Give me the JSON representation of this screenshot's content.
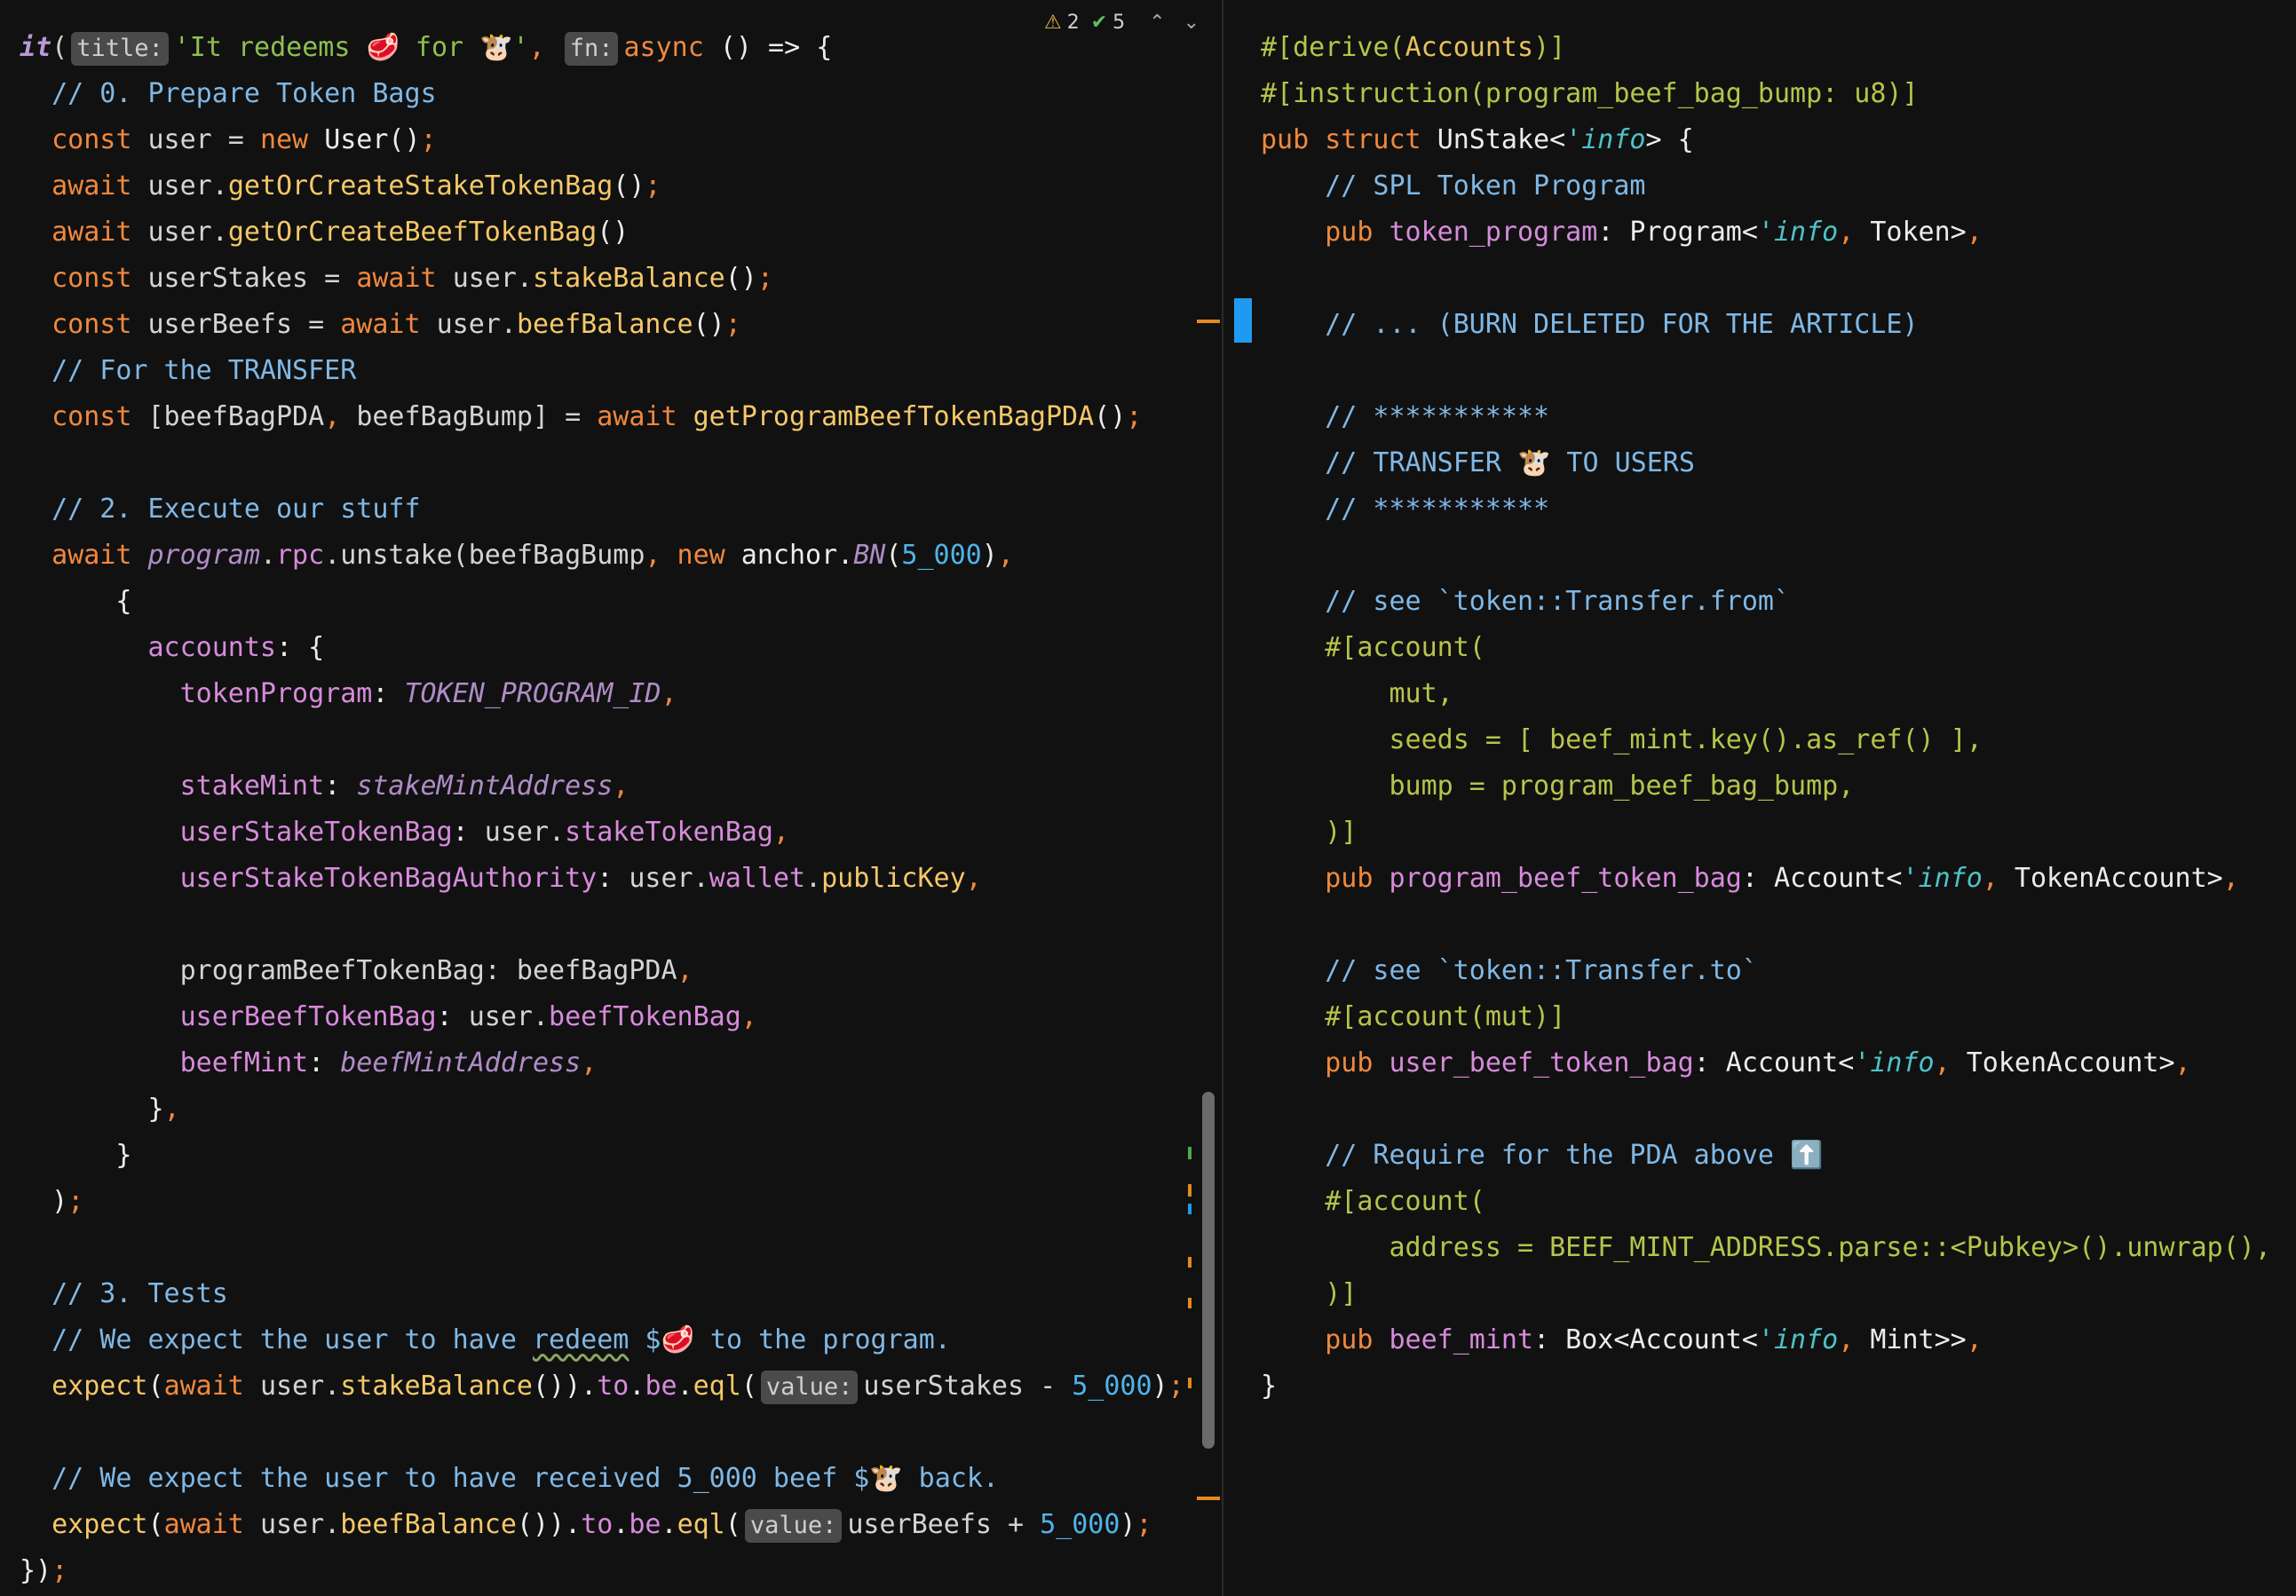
{
  "toolbar": {
    "warning_icon": "warning-triangle-icon",
    "warning_count": "2",
    "ok_icon": "check-double-icon",
    "ok_count": "5",
    "up_icon": "chevron-up-icon",
    "down_icon": "chevron-down-icon"
  },
  "left_editor": {
    "language": "typescript",
    "lines": [
      "it( title: 'It redeems 🥩 for 🐮', fn: async () => {",
      "// 0. Prepare Token Bags",
      "const user = new User();",
      "await user.getOrCreateStakeTokenBag();",
      "await user.getOrCreateBeefTokenBag()",
      "const userStakes = await user.stakeBalance();",
      "const userBeefs = await user.beefBalance();",
      "// For the TRANSFER",
      "const [beefBagPDA, beefBagBump] = await getProgramBeefTokenBagPDA();",
      "",
      "// 2. Execute our stuff",
      "await program.rpc.unstake(beefBagBump, new anchor.BN(5_000),",
      "{",
      "accounts: {",
      "tokenProgram: TOKEN_PROGRAM_ID,",
      "",
      "stakeMint: stakeMintAddress,",
      "userStakeTokenBag: user.stakeTokenBag,",
      "userStakeTokenBagAuthority: user.wallet.publicKey,",
      "",
      "programBeefTokenBag: beefBagPDA,",
      "userBeefTokenBag: user.beefTokenBag,",
      "beefMint: beefMintAddress,",
      "},",
      "}",
      ");",
      "",
      "// 3. Tests",
      "// We expect the user to have redeem $🥩 to the program.",
      "expect(await user.stakeBalance()).to.be.eql( value: userStakes - 5_000);",
      "",
      "// We expect the user to have received 5_000 beef $🐮 back.",
      "expect(await user.beefBalance()).to.be.eql( value: userBeefs + 5_000);",
      "});"
    ],
    "hints": {
      "title": "title:",
      "fn": "fn:",
      "value": "value:"
    }
  },
  "right_editor": {
    "language": "rust",
    "lines": [
      "#[derive(Accounts)]",
      "#[instruction(program_beef_bag_bump: u8)]",
      "pub struct UnStake<'info> {",
      "// SPL Token Program",
      "pub token_program: Program<'info, Token>,",
      "",
      "// ... (BURN DELETED FOR THE ARTICLE)",
      "",
      "// ***********",
      "// TRANSFER 🐮 TO USERS",
      "// ***********",
      "",
      "// see `token::Transfer.from`",
      "#[account(",
      "mut,",
      "seeds = [ beef_mint.key().as_ref() ],",
      "bump = program_beef_bag_bump,",
      ")]",
      "pub program_beef_token_bag: Account<'info, TokenAccount>,",
      "",
      "// see `token::Transfer.to`",
      "#[account(mut)]",
      "pub user_beef_token_bag: Account<'info, TokenAccount>,",
      "",
      "// Require for the PDA above ⬆️",
      "#[account(",
      "address = BEEF_MINT_ADDRESS.parse::<Pubkey>().unwrap(),",
      ")]",
      "pub beef_mint: Box<Account<'info, Mint>>,",
      "}"
    ]
  },
  "colors": {
    "background": "#111111",
    "keyword": "#f0883e",
    "string": "#8fbf4f",
    "comment": "#7fb8e6",
    "property": "#d78bdc",
    "number": "#4fb3e8",
    "bookmark": "#1e9bf0"
  }
}
